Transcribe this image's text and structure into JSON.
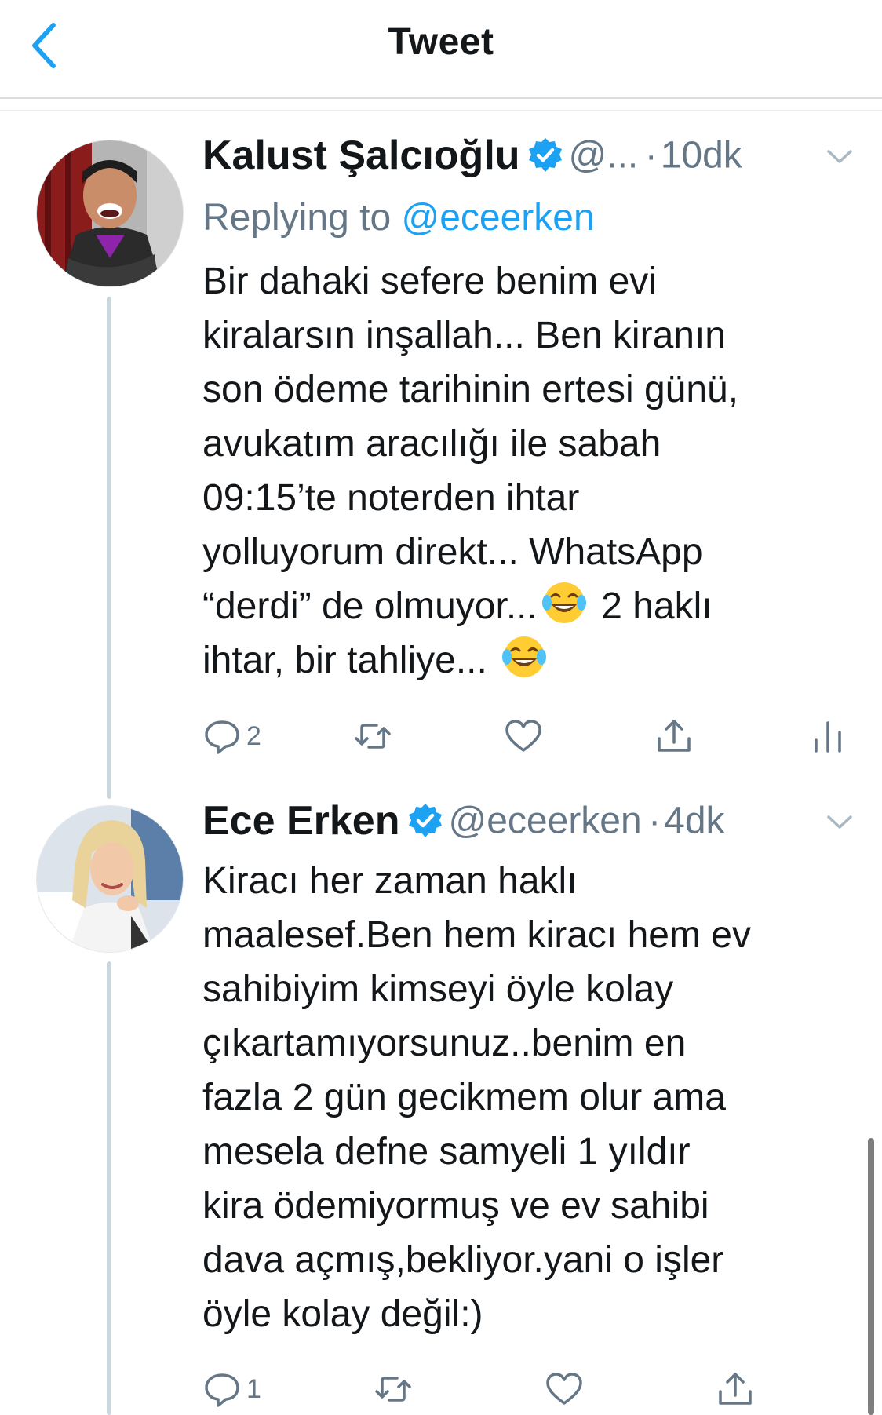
{
  "header": {
    "title": "Tweet"
  },
  "tweets": [
    {
      "name": "Kalust Şalcıoğlu",
      "handle": "@...",
      "dot": "·",
      "time": "10dk",
      "replying_prefix": "Replying to",
      "replying_to": "@eceerken",
      "lines": [
        "Bir dahaki sefere benim evi",
        "kiralarsın inşallah... Ben kiranın",
        "son ödeme tarihinin ertesi günü,",
        "avukatım aracılığı ile sabah",
        "09:15’te noterden ihtar",
        "yolluyorum direkt... WhatsApp",
        "“derdi” de olmuyor...",
        "2 haklı",
        "ihtar, bir tahliye..."
      ],
      "reply_count": "2",
      "emoji": "face-with-tears-of-joy"
    },
    {
      "name": "Ece Erken",
      "handle": "@eceerken",
      "dot": "·",
      "time": "4dk",
      "lines": [
        "Kiracı her zaman haklı",
        "maalesef.Ben hem kiracı hem ev",
        "sahibiyim kimseyi öyle kolay",
        "çıkartamıyorsunuz..benim en",
        "fazla 2 gün gecikmem olur ama",
        "mesela defne samyeli 1 yıldır",
        "kira ödemiyormuş ve ev sahibi",
        "dava açmış,bekliyor.yani o işler",
        "öyle kolay değil:)"
      ],
      "reply_count": "1"
    }
  ],
  "icons": {
    "back": "chevron-left-icon",
    "verified": "verified-badge-icon",
    "caret": "chevron-down-icon",
    "reply": "reply-icon",
    "retweet": "retweet-icon",
    "like": "heart-icon",
    "share": "share-icon",
    "analytics": "analytics-icon"
  },
  "colors": {
    "accent": "#1da1f2",
    "secondary_text": "#657786",
    "thread_line": "#ccd6dd"
  }
}
